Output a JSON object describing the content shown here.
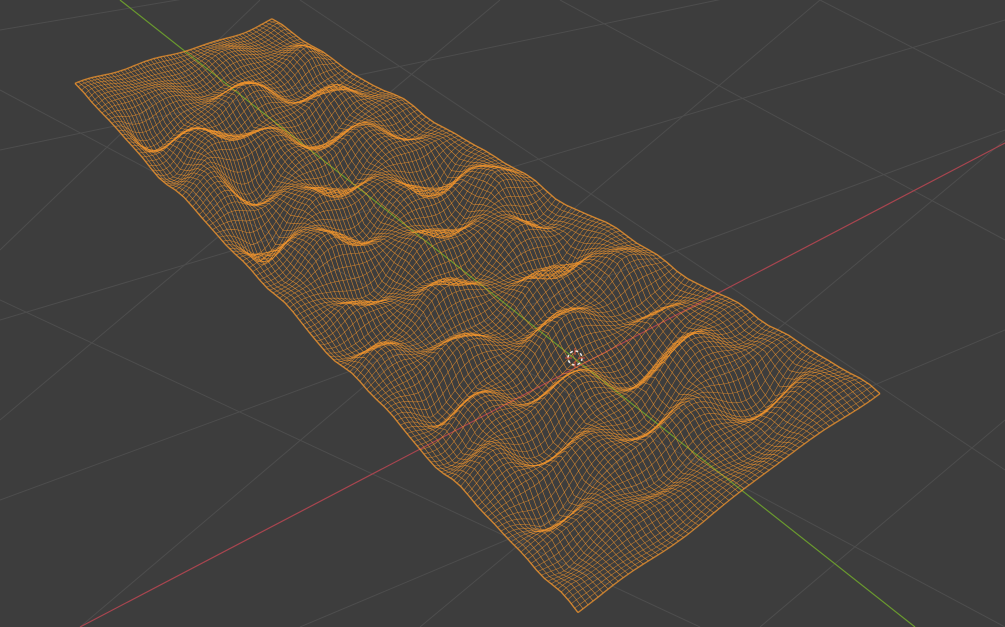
{
  "viewport": {
    "kind": "3D viewport",
    "shading": "wireframe",
    "background_color": "#3d3d3d",
    "grid_color": "#4d4d4d",
    "x_axis_color": "#a8454f",
    "y_axis_color": "#6a9a2e"
  },
  "object": {
    "type": "terrain mesh",
    "state": "selected",
    "wire_color": "#f3962e"
  },
  "cursor": {
    "type": "3d-cursor",
    "colors": [
      "#e6e6e6",
      "#d24a3a"
    ]
  }
}
